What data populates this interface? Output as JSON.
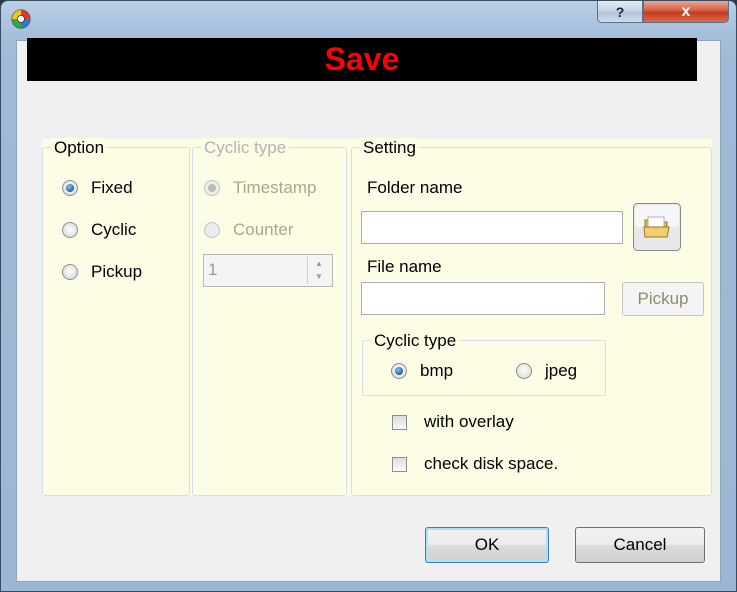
{
  "window": {
    "help_label": "?",
    "close_label": "x"
  },
  "banner": {
    "title": "Save",
    "color": "#ff0000"
  },
  "option_group": {
    "legend": "Option",
    "options": [
      {
        "label": "Fixed",
        "checked": true
      },
      {
        "label": "Cyclic",
        "checked": false
      },
      {
        "label": "Pickup",
        "checked": false
      }
    ]
  },
  "cyclic_group": {
    "legend": "Cyclic type",
    "options": [
      {
        "label": "Timestamp",
        "checked": true
      },
      {
        "label": "Counter",
        "checked": false
      }
    ],
    "counter_value": "1"
  },
  "setting_group": {
    "legend": "Setting",
    "folder_label": "Folder name",
    "folder_value": "",
    "file_label": "File name",
    "file_value": "",
    "pickup_button": "Pickup",
    "cyclic_type": {
      "legend": "Cyclic type",
      "options": [
        {
          "label": "bmp",
          "checked": true
        },
        {
          "label": "jpeg",
          "checked": false
        }
      ]
    },
    "with_overlay": "with overlay",
    "check_disk_space": "check disk space."
  },
  "buttons": {
    "ok": "OK",
    "cancel": "Cancel"
  }
}
